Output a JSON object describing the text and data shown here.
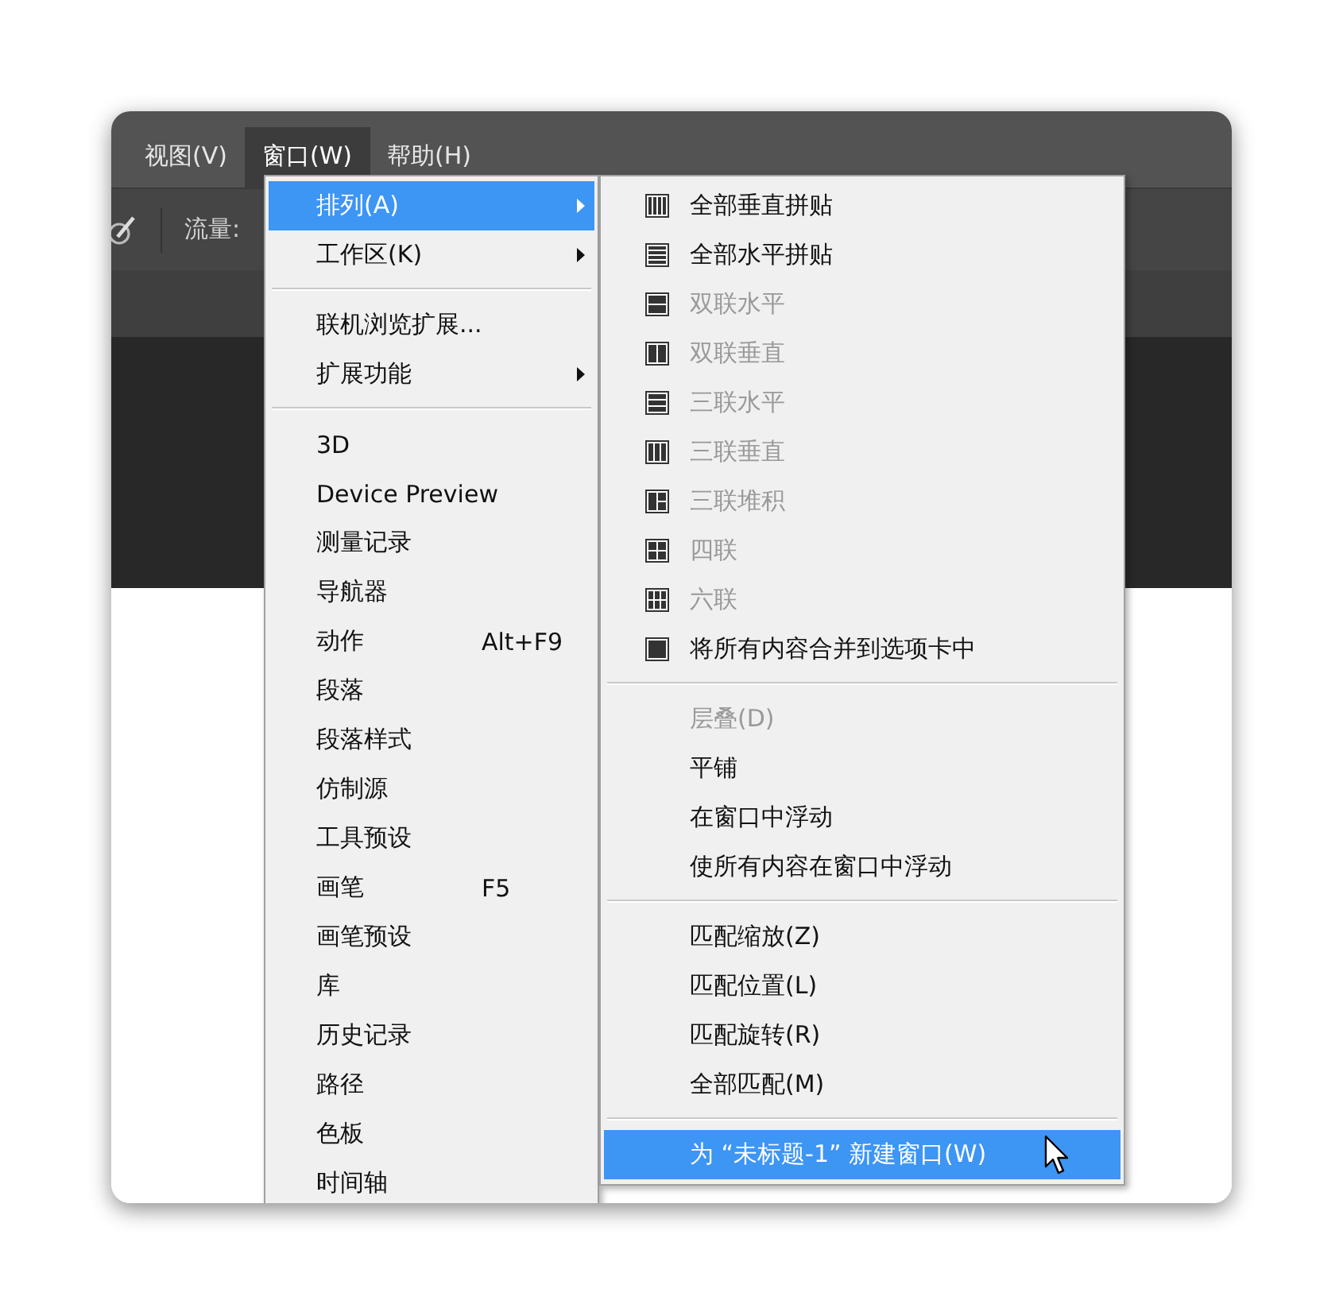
{
  "menu_bar": [
    {
      "label": "视图(V)",
      "selected": false
    },
    {
      "label": "窗口(W)",
      "selected": true
    },
    {
      "label": "帮助(H)",
      "selected": false
    }
  ],
  "toolbar": {
    "label": "流量:"
  },
  "window_menu": [
    {
      "kind": "item",
      "label": "排列(A)",
      "selected": true,
      "has_submenu": true
    },
    {
      "kind": "item",
      "label": "工作区(K)",
      "selected": false,
      "has_submenu": true
    },
    {
      "kind": "separator"
    },
    {
      "kind": "item",
      "label": "联机浏览扩展...",
      "selected": false,
      "has_submenu": false
    },
    {
      "kind": "item",
      "label": "扩展功能",
      "selected": false,
      "has_submenu": true
    },
    {
      "kind": "separator"
    },
    {
      "kind": "item",
      "label": "3D",
      "selected": false,
      "has_submenu": false
    },
    {
      "kind": "item",
      "label": "Device Preview",
      "selected": false,
      "has_submenu": false
    },
    {
      "kind": "item",
      "label": "测量记录",
      "selected": false,
      "has_submenu": false
    },
    {
      "kind": "item",
      "label": "导航器",
      "selected": false,
      "has_submenu": false
    },
    {
      "kind": "item",
      "label": "动作",
      "shortcut": "Alt+F9",
      "selected": false,
      "has_submenu": false
    },
    {
      "kind": "item",
      "label": "段落",
      "selected": false,
      "has_submenu": false
    },
    {
      "kind": "item",
      "label": "段落样式",
      "selected": false,
      "has_submenu": false
    },
    {
      "kind": "item",
      "label": "仿制源",
      "selected": false,
      "has_submenu": false
    },
    {
      "kind": "item",
      "label": "工具预设",
      "selected": false,
      "has_submenu": false
    },
    {
      "kind": "item",
      "label": "画笔",
      "shortcut": "F5",
      "selected": false,
      "has_submenu": false
    },
    {
      "kind": "item",
      "label": "画笔预设",
      "selected": false,
      "has_submenu": false
    },
    {
      "kind": "item",
      "label": "库",
      "selected": false,
      "has_submenu": false
    },
    {
      "kind": "item",
      "label": "历史记录",
      "selected": false,
      "has_submenu": false
    },
    {
      "kind": "item",
      "label": "路径",
      "selected": false,
      "has_submenu": false
    },
    {
      "kind": "item",
      "label": "色板",
      "selected": false,
      "has_submenu": false
    },
    {
      "kind": "item",
      "label": "时间轴",
      "selected": false,
      "has_submenu": false
    }
  ],
  "arrange_submenu": [
    {
      "kind": "cols4",
      "label": "全部垂直拼贴",
      "selected": false,
      "disabled": false
    },
    {
      "kind": "rows4",
      "label": "全部水平拼贴",
      "selected": false,
      "disabled": false
    },
    {
      "kind": "rows2",
      "label": "双联水平",
      "selected": false,
      "disabled": true
    },
    {
      "kind": "cols2",
      "label": "双联垂直",
      "selected": false,
      "disabled": true
    },
    {
      "kind": "rows3",
      "label": "三联水平",
      "selected": false,
      "disabled": true
    },
    {
      "kind": "cols3",
      "label": "三联垂直",
      "selected": false,
      "disabled": true
    },
    {
      "kind": "stack3",
      "label": "三联堆积",
      "selected": false,
      "disabled": true
    },
    {
      "kind": "grid4",
      "label": "四联",
      "selected": false,
      "disabled": true
    },
    {
      "kind": "grid6",
      "label": "六联",
      "selected": false,
      "disabled": true
    },
    {
      "kind": "single",
      "label": "将所有内容合并到选项卡中",
      "selected": false,
      "disabled": false
    },
    {
      "kind": "separator"
    },
    {
      "kind": "text",
      "label": "层叠(D)",
      "selected": false,
      "disabled": true
    },
    {
      "kind": "text",
      "label": "平铺",
      "selected": false,
      "disabled": false
    },
    {
      "kind": "text",
      "label": "在窗口中浮动",
      "selected": false,
      "disabled": false
    },
    {
      "kind": "text",
      "label": "使所有内容在窗口中浮动",
      "selected": false,
      "disabled": false
    },
    {
      "kind": "separator"
    },
    {
      "kind": "text",
      "label": "匹配缩放(Z)",
      "selected": false,
      "disabled": false
    },
    {
      "kind": "text",
      "label": "匹配位置(L)",
      "selected": false,
      "disabled": false
    },
    {
      "kind": "text",
      "label": "匹配旋转(R)",
      "selected": false,
      "disabled": false
    },
    {
      "kind": "text",
      "label": "全部匹配(M)",
      "selected": false,
      "disabled": false
    },
    {
      "kind": "separator"
    },
    {
      "kind": "text",
      "label": "为 “未标题-1” 新建窗口(W)",
      "selected": true,
      "disabled": false
    }
  ]
}
